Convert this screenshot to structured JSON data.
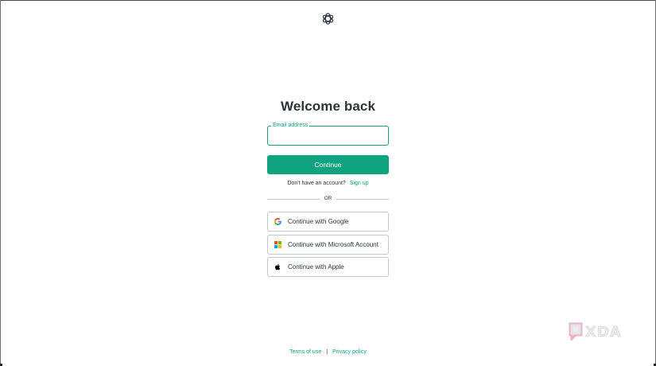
{
  "page": {
    "title": "Welcome back"
  },
  "login_form": {
    "email_label": "Email address",
    "email_value": "",
    "continue_label": "Continue",
    "no_account_text": "Don't have an account?",
    "signup_label": "Sign up",
    "divider_text": "OR"
  },
  "social_logins": [
    {
      "label": "Continue with Google",
      "icon": "google-icon"
    },
    {
      "label": "Continue with Microsoft Account",
      "icon": "microsoft-icon"
    },
    {
      "label": "Continue with Apple",
      "icon": "apple-icon"
    }
  ],
  "footer": {
    "terms_label": "Terms of use",
    "separator": "|",
    "privacy_label": "Privacy policy"
  },
  "watermark": {
    "text": "XDA"
  },
  "colors": {
    "accent": "#10a37f",
    "text": "#2d333a",
    "border": "#c2c8d0"
  }
}
